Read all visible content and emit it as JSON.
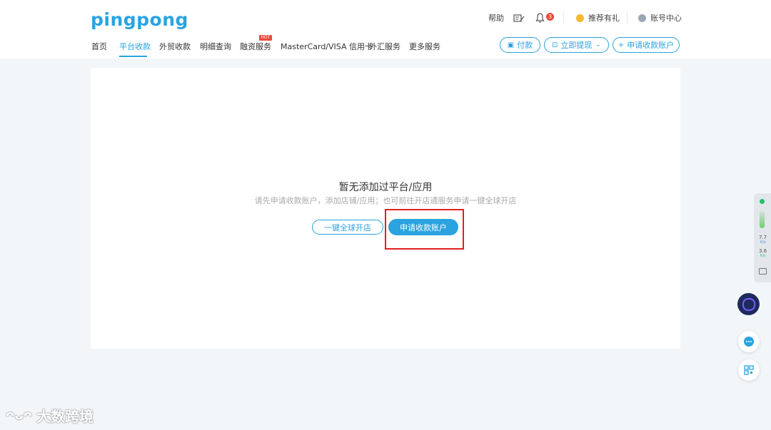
{
  "header": {
    "logo": "pingpong",
    "help": "帮助",
    "notification_count": "3",
    "referral": "推荐有礼",
    "account_center": "账号中心"
  },
  "nav": {
    "items": [
      "首页",
      "平台收款",
      "外贸收款",
      "明细查询",
      "融资服务",
      "MasterCard/VISA 信用卡",
      "外汇服务",
      "更多服务"
    ],
    "active_index": 1,
    "hot_badge": "HOT"
  },
  "actions": {
    "pay": "付款",
    "withdraw": "立即提现",
    "apply_account": "申请收款账户"
  },
  "empty_state": {
    "title": "暂无添加过平台/应用",
    "subtitle": "请先申请收款账户，添加店铺/应用；也可前往开店通服务申请一键全球开店",
    "secondary_button": "一键全球开店",
    "primary_button": "申请收款账户"
  },
  "side_panel": {
    "stat1": "7.7",
    "stat1_unit": "K/s",
    "stat2": "3.6",
    "stat2_unit": "K/s"
  },
  "watermark": "大数跨境",
  "colors": {
    "accent": "#2aa3e0",
    "badge": "#e84b3c",
    "highlight_box": "#e02020",
    "background": "#f3f6f9"
  }
}
